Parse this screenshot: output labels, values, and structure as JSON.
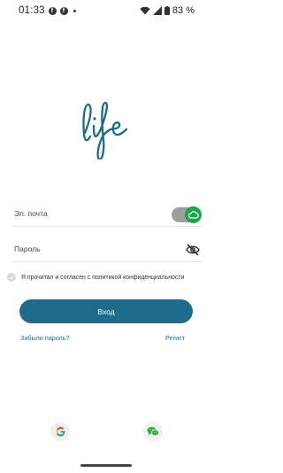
{
  "status_bar": {
    "time": "01:33",
    "battery": "83 %"
  },
  "logo": {
    "text": "life",
    "color": "#1e6b8c"
  },
  "form": {
    "email_label": "Эл. почта",
    "password_label": "Пароль",
    "consent_text": "Я прочитал и согласен с политикой конфиденциальности",
    "login_button": "Вход",
    "forgot_password": "Забыли пароль?",
    "register": "Регист"
  },
  "colors": {
    "accent": "#1e6b8c",
    "toggle_on": "#1aa64a"
  },
  "social": [
    "google-icon",
    "wechat-icon"
  ]
}
